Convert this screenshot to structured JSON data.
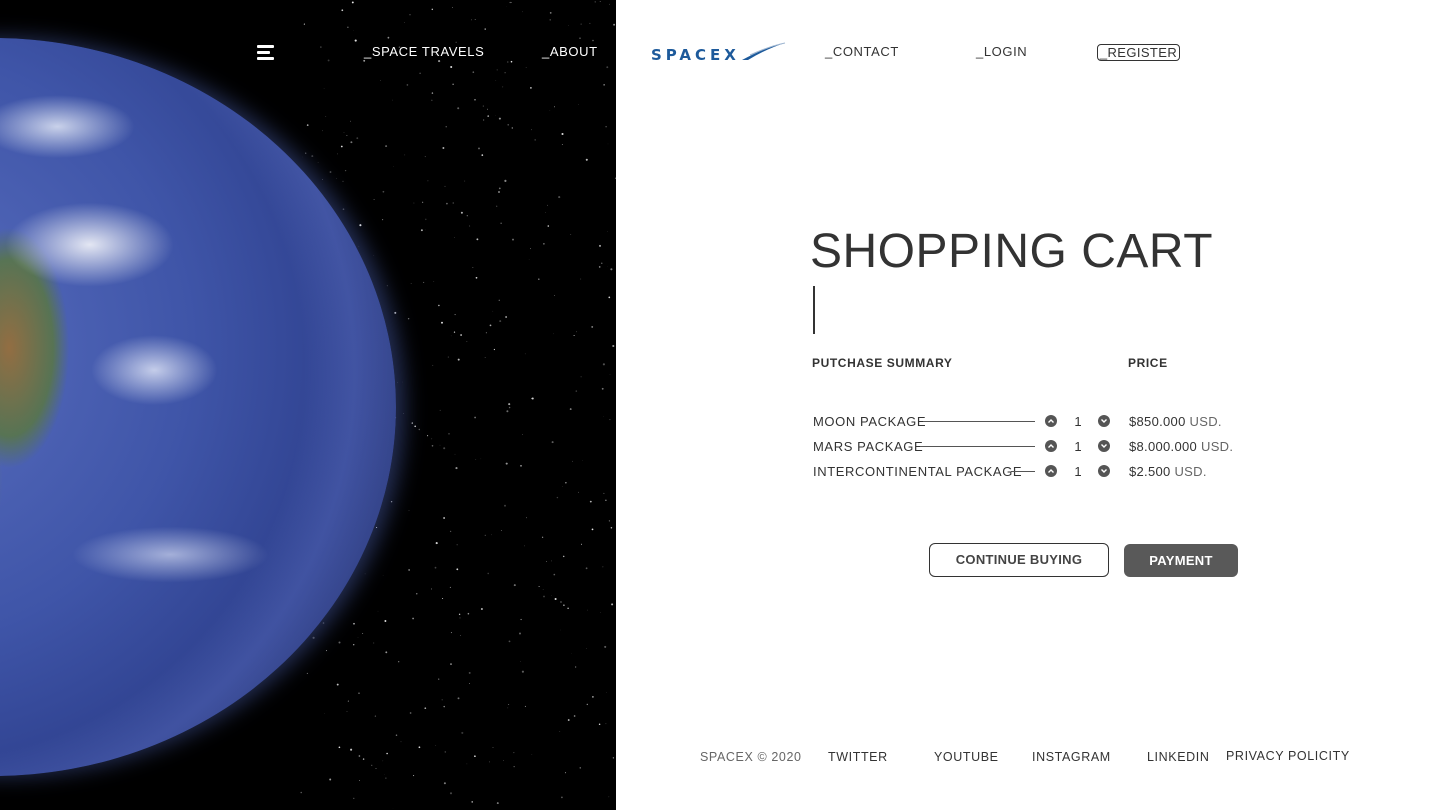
{
  "left_nav": {
    "links": [
      {
        "label": "_SPACE TRAVELS"
      },
      {
        "label": "_ABOUT"
      }
    ]
  },
  "header": {
    "logo_text": "SPACEX",
    "links": [
      {
        "label": "_CONTACT"
      },
      {
        "label": "_LOGIN"
      }
    ],
    "register_label": "_REGISTER"
  },
  "cart": {
    "title": "SHOPPING CART",
    "summary_header": "PUTCHASE SUMMARY",
    "price_header": "PRICE",
    "items": [
      {
        "name": "MOON PACKAGE",
        "qty": "1",
        "price": "$850.000",
        "currency": "USD."
      },
      {
        "name": "MARS PACKAGE",
        "qty": "1",
        "price": "$8.000.000",
        "currency": "USD."
      },
      {
        "name": "INTERCONTINENTAL PACKAGE",
        "qty": "1",
        "price": "$2.500",
        "currency": "USD."
      }
    ],
    "continue_label": "CONTINUE BUYING",
    "payment_label": "PAYMENT"
  },
  "footer": {
    "copyright": "SPACEX © 2020",
    "links": [
      {
        "label": "TWITTER"
      },
      {
        "label": "YOUTUBE"
      },
      {
        "label": "INSTAGRAM"
      },
      {
        "label": "LINKEDIN"
      },
      {
        "label": "PRIVACY POLICITY"
      }
    ]
  },
  "colors": {
    "space_background": "#000000",
    "text": "#333333",
    "logo_blue": "#1d5a9b",
    "payment_button": "#595959"
  },
  "icons": [
    "menu-icon",
    "chevron-up-icon",
    "chevron-down-icon",
    "spacex-logo"
  ]
}
